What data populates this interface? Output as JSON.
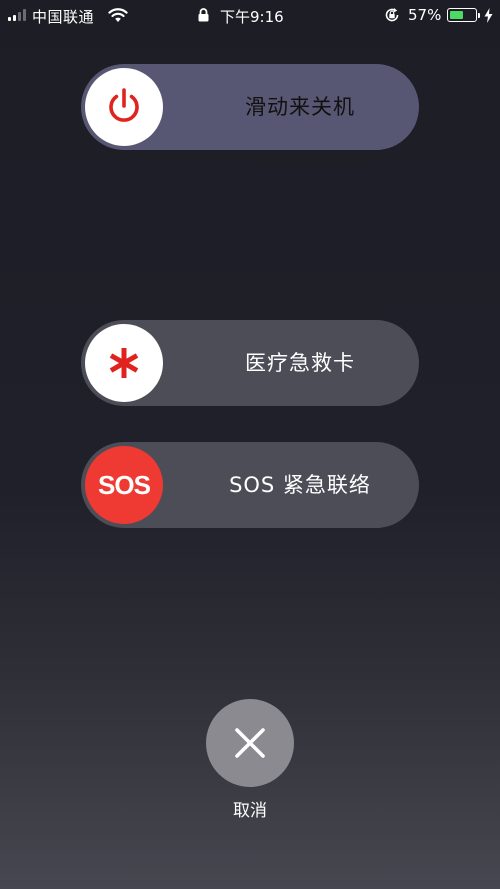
{
  "status_bar": {
    "carrier": "中国联通",
    "time": "下午9:16",
    "battery_percent": "57%",
    "battery_level": 0.57,
    "signal_bars_filled": 2,
    "signal_bars_total": 4,
    "icons": [
      "signal-icon",
      "wifi-icon",
      "lock-icon",
      "orientation-lock-icon",
      "battery-icon",
      "charging-bolt-icon"
    ]
  },
  "power_slider": {
    "label": "滑动来关机",
    "icon": "power-icon",
    "accent_color": "#e0231f"
  },
  "medical_slider": {
    "label": "医疗急救卡",
    "icon": "asterisk-icon",
    "accent_color": "#e0231f"
  },
  "sos_slider": {
    "knob_text": "SOS",
    "label": "SOS 紧急联络",
    "knob_color": "#ee3a33"
  },
  "cancel": {
    "label": "取消",
    "icon": "close-icon"
  }
}
